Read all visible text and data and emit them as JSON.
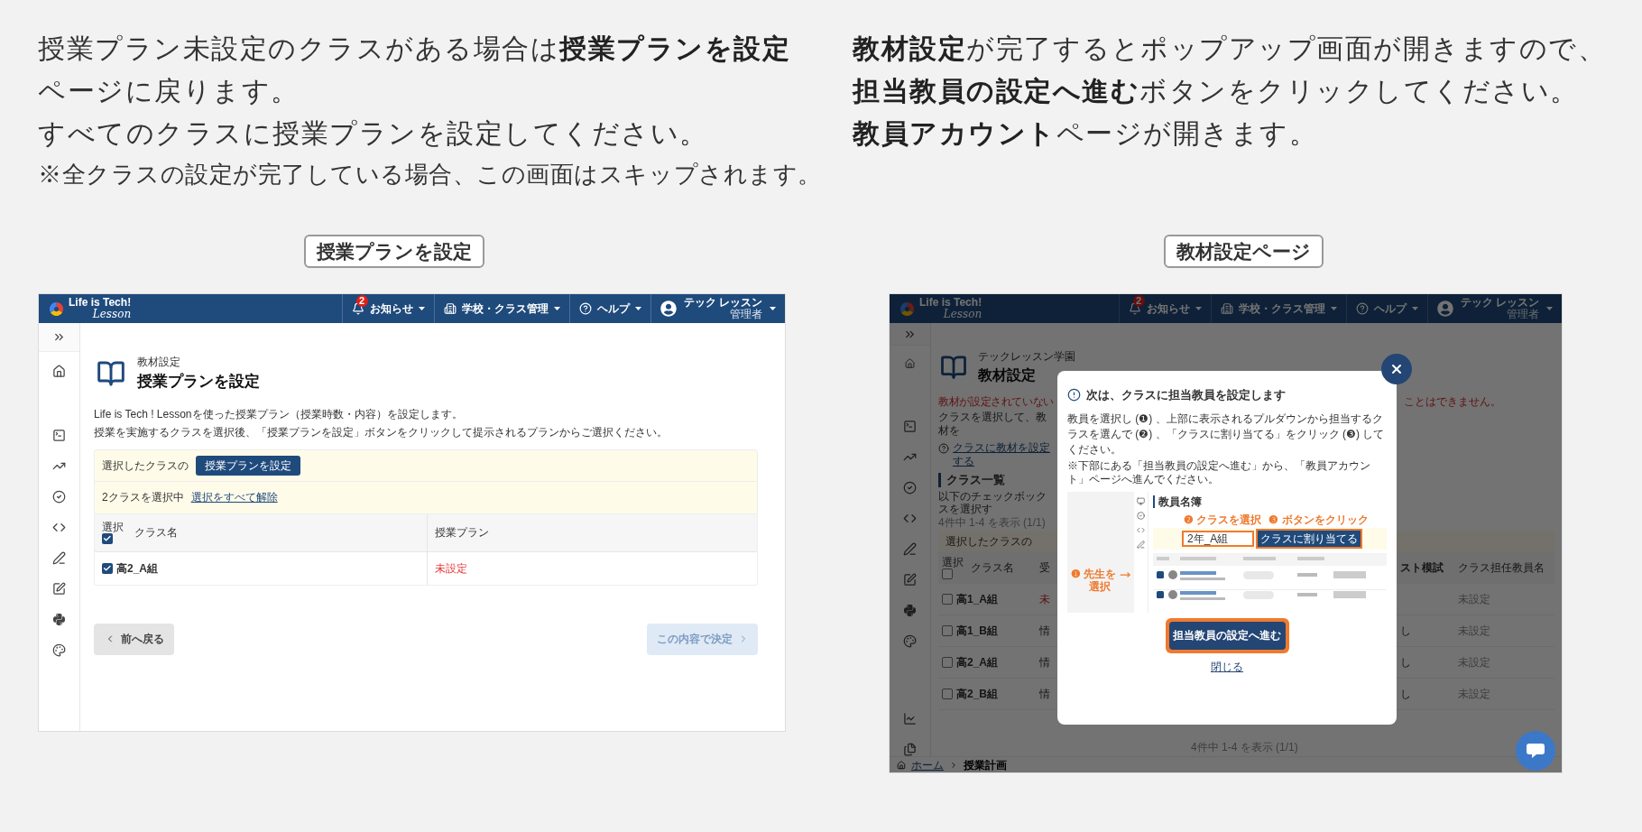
{
  "intro_left": {
    "lines": [
      "授業プラン未設定のクラスがある場合は**授業プランを設定**",
      "ページに戻ります。",
      "すべてのクラスに授業プランを設定してください。"
    ],
    "note": "※全クラスの設定が完了している場合、この画面はスキップされます。",
    "caption": "授業プランを設定"
  },
  "intro_right": {
    "lines": [
      "**教材設定**が完了するとポップアップ画面が開きますので、",
      "**担当教員の設定へ進む**ボタンをクリックしてください。",
      "**教員アカウント**ページが開きます。"
    ],
    "caption": "教材設定ページ"
  },
  "app_left": {
    "header": {
      "logo": "Life is Tech!",
      "logo_sub": "Lesson",
      "nav": [
        {
          "kind": "notice",
          "label": "お知らせ",
          "badge": "2"
        },
        {
          "kind": "school",
          "label": "学校・クラス管理"
        },
        {
          "kind": "help",
          "label": "ヘルプ"
        }
      ],
      "user": {
        "name": "テック レッスン",
        "role": "管理者"
      }
    },
    "page": {
      "overline": "教材設定",
      "title": "授業プランを設定",
      "description": [
        "Life is Tech ! Lessonを使った授業プラン（授業時数・内容）を設定します。",
        "授業を実施するクラスを選択後、「授業プランを設定」ボタンをクリックして提示されるプランからご選択ください。"
      ]
    },
    "selection_bar": {
      "label": "選択したクラスの",
      "button": "授業プランを設定",
      "count": "2クラスを選択中",
      "clear_link": "選択をすべて解除"
    },
    "table": {
      "select_label": "選択",
      "select_all_checked": true,
      "columns": [
        "クラス名",
        "授業プラン"
      ],
      "rows": [
        {
          "checked": true,
          "name": "高2_A組",
          "plan": "未設定",
          "warning": true
        }
      ]
    },
    "buttons": {
      "back": "前へ戻る",
      "confirm": {
        "label": "この内容で決定",
        "disabled": true
      }
    }
  },
  "app_right": {
    "header": {
      "logo": "Life is Tech!",
      "logo_sub": "Lesson",
      "nav": [
        {
          "kind": "notice",
          "label": "お知らせ",
          "badge": "2"
        },
        {
          "kind": "school",
          "label": "学校・クラス管理"
        },
        {
          "kind": "help",
          "label": "ヘルプ"
        }
      ],
      "user": {
        "name": "テック レッスン",
        "role": "管理者"
      }
    },
    "page": {
      "overline": "テックレッスン学園",
      "title": "教材設定",
      "warning_start": "教材が設定されていない",
      "warning_end": "ことはできません。",
      "instruction": "クラスを選択して、教材を",
      "help_link": "クラスに教材を設定する",
      "section": "クラス一覧",
      "section_note": "以下のチェックボックスを選択す",
      "count": "4件中 1-4 を表示 (1/1)",
      "selection_label": "選択したクラスの"
    },
    "table": {
      "select_label": "選択",
      "select_all_checked": false,
      "columns": [
        "クラス名",
        "受",
        "スト模試",
        "クラス担任教員名"
      ],
      "rows": [
        {
          "checked": false,
          "name": "高1_A組",
          "course": "未",
          "warning": true,
          "teacher": "未設定"
        },
        {
          "checked": false,
          "name": "高1_B組",
          "course": "情",
          "warning": false,
          "mock": "し",
          "teacher": "未設定"
        },
        {
          "checked": false,
          "name": "高2_A組",
          "course": "情",
          "warning": false,
          "mock": "し",
          "teacher": "未設定"
        },
        {
          "checked": false,
          "name": "高2_B組",
          "course": "情",
          "warning": false,
          "mock": "し",
          "teacher": "未設定"
        }
      ]
    },
    "count_bottom": "4件中 1-4 を表示 (1/1)",
    "breadcrumb": [
      "ホーム",
      "授業計画"
    ],
    "modal": {
      "title": "次は、クラスに担当教員を設定します",
      "body": "教員を選択し (❶) 、上部に表示されるプルダウンから担当するクラスを選んで (❷) 、「クラスに割り当てる」をクリック (❸) してください。",
      "note": "※下部にある「担当教員の設定へ進む」から、「教員アカウント」ページへ進んでください。",
      "guide": {
        "title": "教員名簿",
        "steps": [
          {
            "number": "❶",
            "label": "先生を選択"
          },
          {
            "number": "❷",
            "label": "クラスを選択"
          },
          {
            "number": "❸",
            "label": "ボタンをクリック"
          }
        ],
        "dropdown": "2年_A組",
        "assign_button": "クラスに割り当てる"
      },
      "primary": {
        "label": "担当教員の設定へ進む",
        "highlighted": true
      },
      "close_link": "閉じる"
    }
  }
}
